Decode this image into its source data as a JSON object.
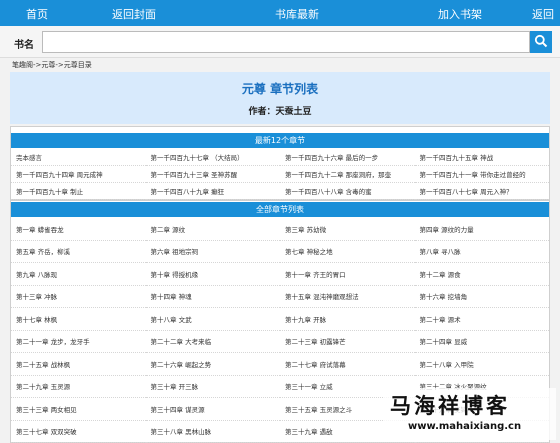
{
  "nav": {
    "home": "首页",
    "back_cover": "返回封面",
    "library_latest": "书库最新",
    "add_shelf": "加入书架",
    "back": "返回"
  },
  "search": {
    "label": "书名",
    "value": "",
    "icon": "search-icon"
  },
  "breadcrumb": "笔趣阁->元尊->元尊目录",
  "book": {
    "title": "元尊 章节列表",
    "author": "作者：天蚕土豆"
  },
  "latest": {
    "header": "最新12个章节",
    "items": [
      "完本感言",
      "第一千四百九十七章 （大结局）",
      "第一千四百九十六章 最后的一步",
      "第一千四百九十五章 神战",
      "第一千四百九十四章 周元成神",
      "第一千四百九十三章 圣神苏醒",
      "第一千四百九十二章 那座洞府，那壶",
      "第一千四百九十一章 带你走过曾经的",
      "第一千四百九十章 制止",
      "第一千四百八十九章 癫狂",
      "第一千四百八十八章 含毒的蜜",
      "第一千四百八十七章 周元入神？"
    ]
  },
  "all": {
    "header": "全部章节列表",
    "items": [
      "第一章 蟒雀吞龙",
      "第二章 源纹",
      "第三章 苏幼微",
      "第四章 源纹的力量",
      "第五章 齐岳，柳溪",
      "第六章 祖地宗祠",
      "第七章 神秘之地",
      "第八章 寻八脉",
      "第九章 八脉现",
      "第十章 得授机缘",
      "第十一章 齐王的胃口",
      "第十二章 源食",
      "第十三章 冲脉",
      "第十四章 神魂",
      "第十五章 混沌神磨观想法",
      "第十六章 挖墙角",
      "第十七章 林枫",
      "第十八章 文武",
      "第十九章 开脉",
      "第二十章 源术",
      "第二十一章 龙步，龙牙手",
      "第二十二章 大考来临",
      "第二十三章 初露锋芒",
      "第二十四章 显威",
      "第二十五章 战林枫",
      "第二十六章 崛起之势",
      "第二十七章 府试落幕",
      "第二十八章 入甲院",
      "第二十九章 玉灵源",
      "第三十章 开三脉",
      "第三十一章 立威",
      "第三十二章 冰火聚源纹",
      "第三十三章 两女相见",
      "第三十四章 谋灵源",
      "第三十五章 玉灵源之斗",
      "第三十六章 交锋",
      "第三十七章 双双突破",
      "第三十八章 黑林山脉",
      "第三十九章 遇敌",
      ""
    ]
  },
  "watermark": {
    "title": "马海祥博客",
    "url": "www.mahaixiang.cn"
  },
  "colors": {
    "accent": "#1a8fd8",
    "title_blue": "#1a6fbf",
    "title_bg": "#d8eafc"
  }
}
